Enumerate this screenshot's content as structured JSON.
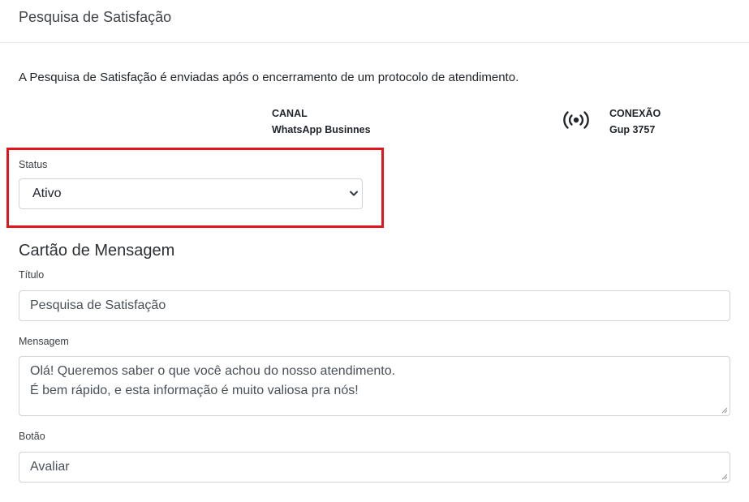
{
  "header": {
    "title": "Pesquisa de Satisfação"
  },
  "intro": "A Pesquisa de Satisfação é enviadas após o encerramento de um protocolo de atendimento.",
  "canal": {
    "label": "CANAL",
    "value": "WhatsApp Businnes"
  },
  "conexao": {
    "label": "CONEXÃO",
    "value": "Gup 3757",
    "icon": "broadcast-signal-icon"
  },
  "status": {
    "label": "Status",
    "value": "Ativo",
    "highlight_color": "#e3141b"
  },
  "message_card": {
    "title": "Cartão de Mensagem",
    "titulo": {
      "label": "Título",
      "value": "Pesquisa de Satisfação"
    },
    "mensagem": {
      "label": "Mensagem",
      "lines": [
        "Olá! Queremos saber o que você achou do nosso atendimento.",
        "É bem rápido, e esta informação é muito valiosa pra nós!"
      ]
    },
    "botao": {
      "label": "Botão",
      "value": "Avaliar"
    }
  }
}
